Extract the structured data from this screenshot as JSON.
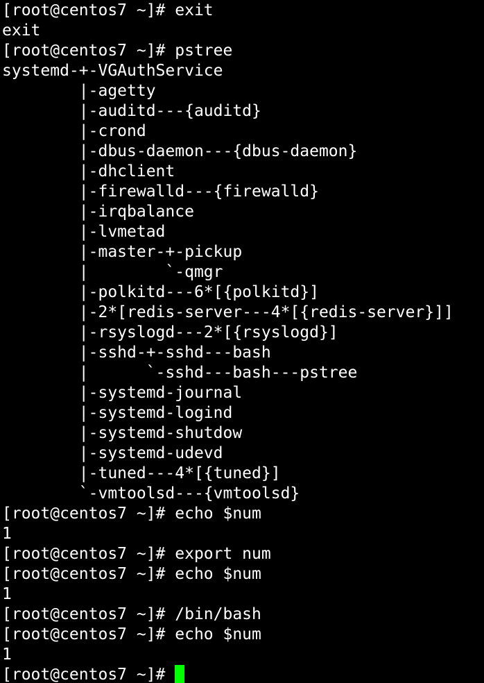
{
  "theme": {
    "background": "#000000",
    "foreground": "#ffffff",
    "cursor": "#00ff00"
  },
  "terminal": {
    "lines": [
      "[root@centos7 ~]# exit",
      "exit",
      "[root@centos7 ~]# pstree",
      "systemd-+-VGAuthService",
      "        |-agetty",
      "        |-auditd---{auditd}",
      "        |-crond",
      "        |-dbus-daemon---{dbus-daemon}",
      "        |-dhclient",
      "        |-firewalld---{firewalld}",
      "        |-irqbalance",
      "        |-lvmetad",
      "        |-master-+-pickup",
      "        |        `-qmgr",
      "        |-polkitd---6*[{polkitd}]",
      "        |-2*[redis-server---4*[{redis-server}]]",
      "        |-rsyslogd---2*[{rsyslogd}]",
      "        |-sshd-+-sshd---bash",
      "        |      `-sshd---bash---pstree",
      "        |-systemd-journal",
      "        |-systemd-logind",
      "        |-systemd-shutdow",
      "        |-systemd-udevd",
      "        |-tuned---4*[{tuned}]",
      "        `-vmtoolsd---{vmtoolsd}",
      "[root@centos7 ~]# echo $num",
      "1",
      "[root@centos7 ~]# export num",
      "[root@centos7 ~]# echo $num",
      "1",
      "[root@centos7 ~]# /bin/bash",
      "[root@centos7 ~]# echo $num",
      "1"
    ],
    "prompt": "[root@centos7 ~]# "
  }
}
